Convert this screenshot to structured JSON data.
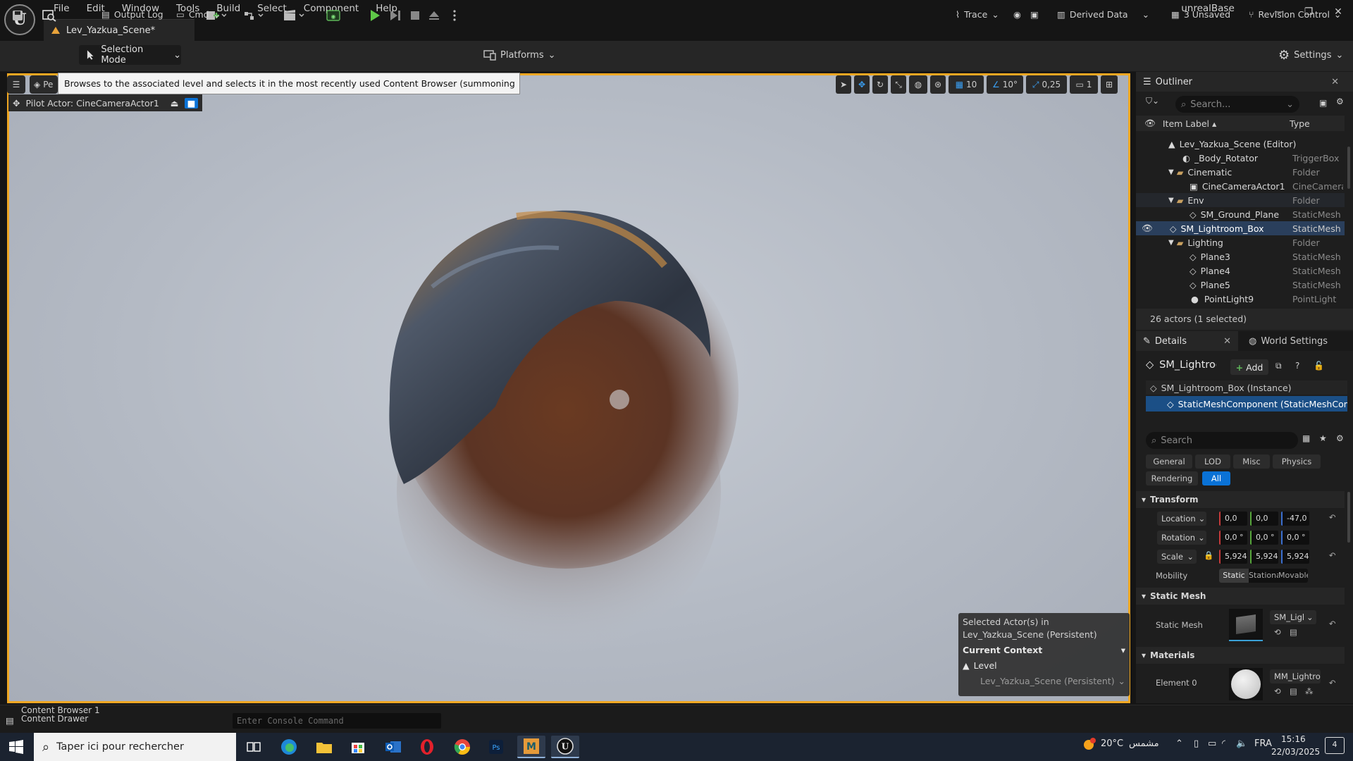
{
  "window": {
    "logo_text": "U",
    "menu": [
      "File",
      "Edit",
      "Window",
      "Tools",
      "Build",
      "Select",
      "Component",
      "Help"
    ],
    "tab_title": "Lev_Yazkua_Scene*",
    "project": "unrealBase",
    "controls": {
      "minimize": "—",
      "restore": "❐",
      "close": "✕"
    }
  },
  "toolbar": {
    "selection_mode": "Selection Mode",
    "platforms": "Platforms",
    "settings": "Settings"
  },
  "viewport": {
    "tooltip": "Browses to the associated level and selects it in the most recently used Content Browser (summoning one if necessary)",
    "perspective_short": "Pe",
    "pilot_actor": "Pilot Actor: CineCameraActor1",
    "grid_snap": "10",
    "rotation_snap": "10°",
    "scale_snap": "0,25",
    "camera_speed": "1",
    "context": {
      "line1": "Selected Actor(s) in",
      "line2": "Lev_Yazkua_Scene (Persistent)",
      "current_context": "Current Context",
      "level_label": "Level",
      "level_value": "Lev_Yazkua_Scene (Persistent)"
    }
  },
  "outliner": {
    "tab": "Outliner",
    "search_placeholder": "Search...",
    "col_label": "Item Label",
    "col_type": "Type",
    "rows": [
      {
        "label": "Lev_Yazkua_Scene (Editor)",
        "type": ""
      },
      {
        "label": "_Body_Rotator",
        "type": "TriggerBox"
      },
      {
        "label": "Cinematic",
        "type": "Folder"
      },
      {
        "label": "CineCameraActor1",
        "type": "CineCamera"
      },
      {
        "label": "Env",
        "type": "Folder"
      },
      {
        "label": "SM_Ground_Plane",
        "type": "StaticMesh"
      },
      {
        "label": "SM_Lightroom_Box",
        "type": "StaticMesh"
      },
      {
        "label": "Lighting",
        "type": "Folder"
      },
      {
        "label": "Plane3",
        "type": "StaticMesh"
      },
      {
        "label": "Plane4",
        "type": "StaticMesh"
      },
      {
        "label": "Plane5",
        "type": "StaticMesh"
      },
      {
        "label": "PointLight9",
        "type": "PointLight"
      }
    ],
    "footer": "26 actors (1 selected)"
  },
  "details": {
    "tab": "Details",
    "tab2": "World Settings",
    "actor_name": "SM_Lightroom_Box",
    "add_label": "Add",
    "instance": "SM_Lightroom_Box (Instance)",
    "component": "StaticMeshComponent (StaticMeshComponent)",
    "search_placeholder": "Search",
    "filters": [
      "General",
      "LOD",
      "Misc",
      "Physics",
      "Rendering",
      "All"
    ],
    "transform": {
      "header": "Transform",
      "location_label": "Location",
      "location": [
        "0,0",
        "0,0",
        "-47,0"
      ],
      "rotation_label": "Rotation",
      "rotation": [
        "0,0 °",
        "0,0 °",
        "0,0 °"
      ],
      "scale_label": "Scale",
      "scale": [
        "5,924",
        "5,924",
        "5,924"
      ],
      "mobility_label": "Mobility",
      "mobility": [
        "Static",
        "Stationary",
        "Movable"
      ]
    },
    "static_mesh": {
      "header": "Static Mesh",
      "label": "Static Mesh",
      "value": "SM_Lightroom_Box"
    },
    "materials": {
      "header": "Materials",
      "label": "Element 0",
      "value": "MM_Lightroom"
    }
  },
  "statusbar": {
    "content_browser": "Content Browser 1",
    "content_drawer": "Content Drawer",
    "output_log": "Output Log",
    "cmd": "Cmd",
    "console_placeholder": "Enter Console Command",
    "trace": "Trace",
    "derived_data": "Derived Data",
    "unsaved": "3 Unsaved",
    "revision_control": "Revision Control"
  },
  "taskbar": {
    "search_placeholder": "Taper ici pour rechercher",
    "temperature": "20°C",
    "weather": "مشمس",
    "language": "FRA",
    "time": "15:16",
    "date": "22/03/2025",
    "notifications": "4"
  }
}
